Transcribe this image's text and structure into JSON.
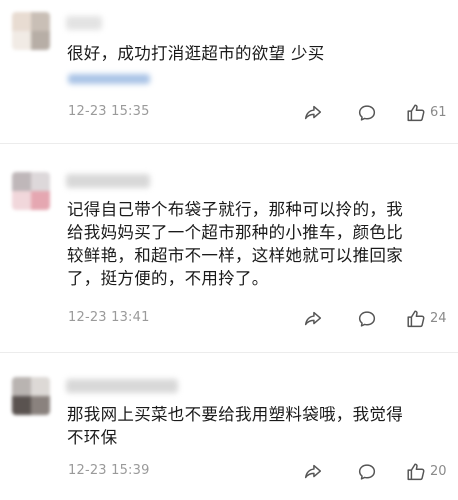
{
  "comments": [
    {
      "text_lines": [
        "很好，成功打消逛超市的欲望 少买"
      ],
      "time": "12-23 15:35",
      "likes": "61"
    },
    {
      "text_lines": [
        "记得自己带个布袋子就行，那种可以拎的，我",
        "给我妈妈买了一个超市那种的小推车，颜色比",
        "较鲜艳，和超市不一样，这样她就可以推回家",
        "了，挺方便的，不用拎了。"
      ],
      "time": "12-23 13:41",
      "likes": "24"
    },
    {
      "text_lines": [
        "那我网上买菜也不要给我用塑料袋哦，我觉得",
        "不环保"
      ],
      "time": "12-23 15:39",
      "likes": "20"
    }
  ],
  "icons": {
    "share": "share-icon",
    "reply": "comment-icon",
    "like": "thumbs-up-icon"
  },
  "colors": {
    "time": "#9a9a9a",
    "icon": "#555555",
    "text": "#1a1a1a"
  }
}
